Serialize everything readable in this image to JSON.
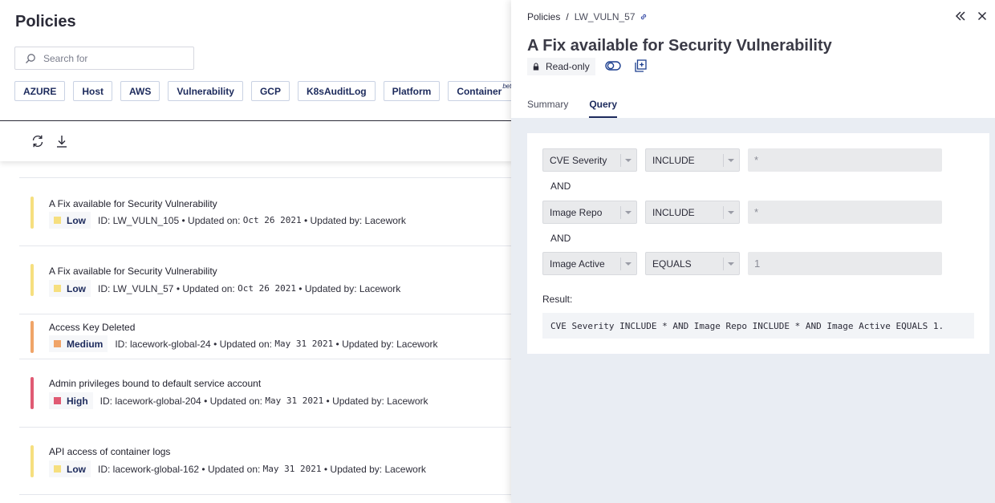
{
  "left": {
    "title": "Policies",
    "search": {
      "placeholder": "Search for",
      "value": ""
    },
    "chips": [
      {
        "label": "AZURE"
      },
      {
        "label": "Host"
      },
      {
        "label": "AWS"
      },
      {
        "label": "Vulnerability"
      },
      {
        "label": "GCP"
      },
      {
        "label": "K8sAuditLog"
      },
      {
        "label": "Platform"
      },
      {
        "label": "Container",
        "badge": "beta"
      }
    ],
    "toolbar": {
      "refresh_icon": "refresh-icon",
      "download_icon": "download-icon"
    },
    "policies": [
      {
        "title": "A Fix available for Security Vulnerability",
        "severity": "Low",
        "severity_color": "#f6df7f",
        "id": "ID: LW_VULN_105",
        "updated_on_label": "• Updated on:",
        "updated_on": "Oct 26 2021",
        "updated_by": "• Updated by: Lacework"
      },
      {
        "title": "A Fix available for Security Vulnerability",
        "severity": "Low",
        "severity_color": "#f6df7f",
        "id": "ID: LW_VULN_57",
        "updated_on_label": "• Updated on:",
        "updated_on": "Oct 26 2021",
        "updated_by": "• Updated by: Lacework"
      },
      {
        "title": "Access Key Deleted",
        "severity": "Medium",
        "severity_color": "#f0a468",
        "id": "ID: lacework-global-24",
        "updated_on_label": "• Updated on:",
        "updated_on": "May 31 2021",
        "updated_by": "• Updated by: Lacework"
      },
      {
        "title": "Admin privileges bound to default service account",
        "severity": "High",
        "severity_color": "#e05a73",
        "id": "ID: lacework-global-204",
        "updated_on_label": "• Updated on:",
        "updated_on": "May 31 2021",
        "updated_by": "• Updated by: Lacework"
      },
      {
        "title": "API access of container logs",
        "severity": "Low",
        "severity_color": "#f6df7f",
        "id": "ID: lacework-global-162",
        "updated_on_label": "• Updated on:",
        "updated_on": "May 31 2021",
        "updated_by": "• Updated by: Lacework"
      }
    ]
  },
  "drawer": {
    "breadcrumb": {
      "root": "Policies",
      "sep": "/",
      "current": "LW_VULN_57"
    },
    "title": "A Fix available for Security Vulnerability",
    "readonly_label": "Read-only",
    "tabs": [
      {
        "label": "Summary"
      },
      {
        "label": "Query",
        "active": true
      }
    ],
    "query": {
      "rows": [
        {
          "field": "CVE Severity",
          "op": "INCLUDE",
          "value": "*"
        },
        {
          "field": "Image Repo",
          "op": "INCLUDE",
          "value": "*"
        },
        {
          "field": "Image Active",
          "op": "EQUALS",
          "value": "1"
        }
      ],
      "connectors": [
        "AND",
        "AND"
      ],
      "result_label": "Result:",
      "result": "CVE Severity INCLUDE * AND Image Repo INCLUDE * AND Image Active EQUALS 1."
    }
  },
  "colors": {
    "accent": "#1c2a5c",
    "drawer_bg": "#e9edf3",
    "chip_border": "#c9d2e3"
  }
}
